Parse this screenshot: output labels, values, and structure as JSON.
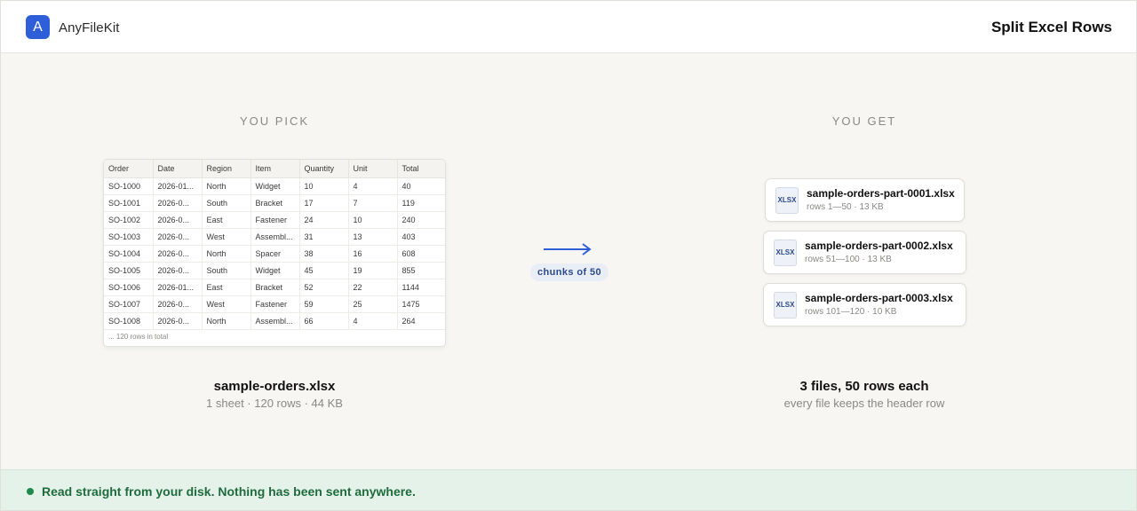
{
  "app": {
    "logo_letter": "A",
    "name": "AnyFileKit",
    "page_title": "Split Excel Rows"
  },
  "input": {
    "section_title": "YOU PICK",
    "columns": [
      "Order",
      "Date",
      "Region",
      "Item",
      "Quantity",
      "Unit",
      "Total"
    ],
    "rows": [
      [
        "SO-1000",
        "2026-01...",
        "North",
        "Widget",
        "10",
        "4",
        "40"
      ],
      [
        "SO-1001",
        "2026-0...",
        "South",
        "Bracket",
        "17",
        "7",
        "119"
      ],
      [
        "SO-1002",
        "2026-0...",
        "East",
        "Fastener",
        "24",
        "10",
        "240"
      ],
      [
        "SO-1003",
        "2026-0...",
        "West",
        "Assembl...",
        "31",
        "13",
        "403"
      ],
      [
        "SO-1004",
        "2026-0...",
        "North",
        "Spacer",
        "38",
        "16",
        "608"
      ],
      [
        "SO-1005",
        "2026-0...",
        "South",
        "Widget",
        "45",
        "19",
        "855"
      ],
      [
        "SO-1006",
        "2026-01...",
        "East",
        "Bracket",
        "52",
        "22",
        "1144"
      ],
      [
        "SO-1007",
        "2026-0...",
        "West",
        "Fastener",
        "59",
        "25",
        "1475"
      ],
      [
        "SO-1008",
        "2026-0...",
        "North",
        "Assembl...",
        "66",
        "4",
        "264"
      ]
    ],
    "footer": "... 120 rows in total",
    "file_name": "sample-orders.xlsx",
    "file_meta": "1 sheet · 120 rows · 44 KB"
  },
  "transform": {
    "chunk_label": "chunks of 50",
    "arrow_color": "#2f5fd8"
  },
  "output": {
    "section_title": "YOU GET",
    "files": [
      {
        "icon_label": "XLSX",
        "name": "sample-orders-part-0001.xlsx",
        "meta": "rows 1—50 · 13 KB"
      },
      {
        "icon_label": "XLSX",
        "name": "sample-orders-part-0002.xlsx",
        "meta": "rows 51—100 · 13 KB"
      },
      {
        "icon_label": "XLSX",
        "name": "sample-orders-part-0003.xlsx",
        "meta": "rows 101—120 · 10 KB"
      }
    ],
    "summary_title": "3 files, 50 rows each",
    "summary_sub": "every file keeps the header row"
  },
  "privacy": {
    "message": "Read straight from your disk. Nothing has been sent anywhere.",
    "status_color": "#1f8a4c"
  }
}
